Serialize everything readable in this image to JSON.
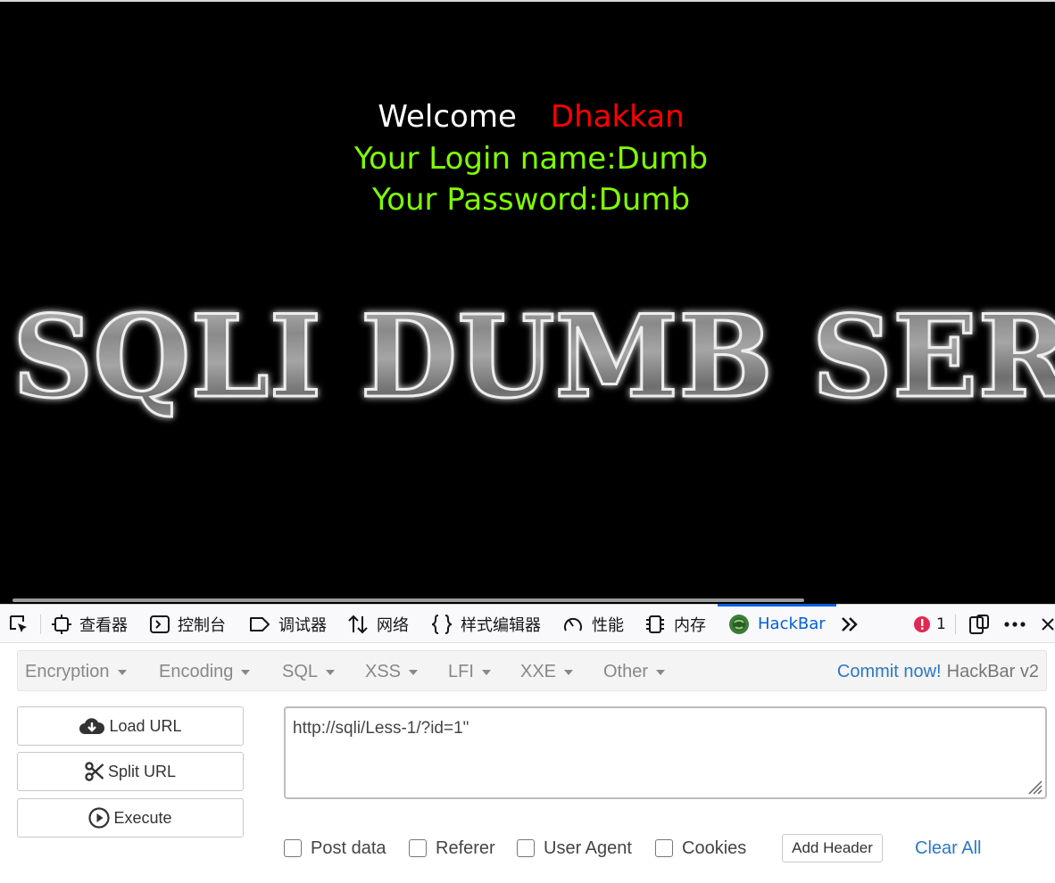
{
  "page": {
    "welcome_label": "Welcome",
    "welcome_name": "Dhakkan",
    "login_line": "Your Login name:Dumb",
    "password_line": "Your Password:Dumb",
    "banner_text": "SQLI DUMB SERIES",
    "colors": {
      "background": "#000000",
      "welcome": "#ffffff",
      "name": "#ff0000",
      "info": "#7fff00"
    }
  },
  "devtools": {
    "tabs": [
      {
        "label": "查看器",
        "icon": "inspector-icon"
      },
      {
        "label": "控制台",
        "icon": "console-icon"
      },
      {
        "label": "调试器",
        "icon": "debugger-icon"
      },
      {
        "label": "网络",
        "icon": "network-icon"
      },
      {
        "label": "样式编辑器",
        "icon": "style-editor-icon"
      },
      {
        "label": "性能",
        "icon": "performance-icon"
      },
      {
        "label": "内存",
        "icon": "memory-icon"
      },
      {
        "label": "HackBar",
        "icon": "hackbar-icon",
        "active": true
      }
    ],
    "error_count": "1",
    "accent": "#0060df"
  },
  "hackbar": {
    "menu": [
      "Encryption",
      "Encoding",
      "SQL",
      "XSS",
      "LFI",
      "XXE",
      "Other"
    ],
    "commit_link": "Commit now!",
    "version": "HackBar v2",
    "buttons": {
      "load": "Load URL",
      "split": "Split URL",
      "execute": "Execute"
    },
    "url": "http://sqli/Less-1/?id=1\"",
    "options": [
      "Post data",
      "Referer",
      "User Agent",
      "Cookies"
    ],
    "add_header": "Add Header",
    "clear_all": "Clear All"
  }
}
